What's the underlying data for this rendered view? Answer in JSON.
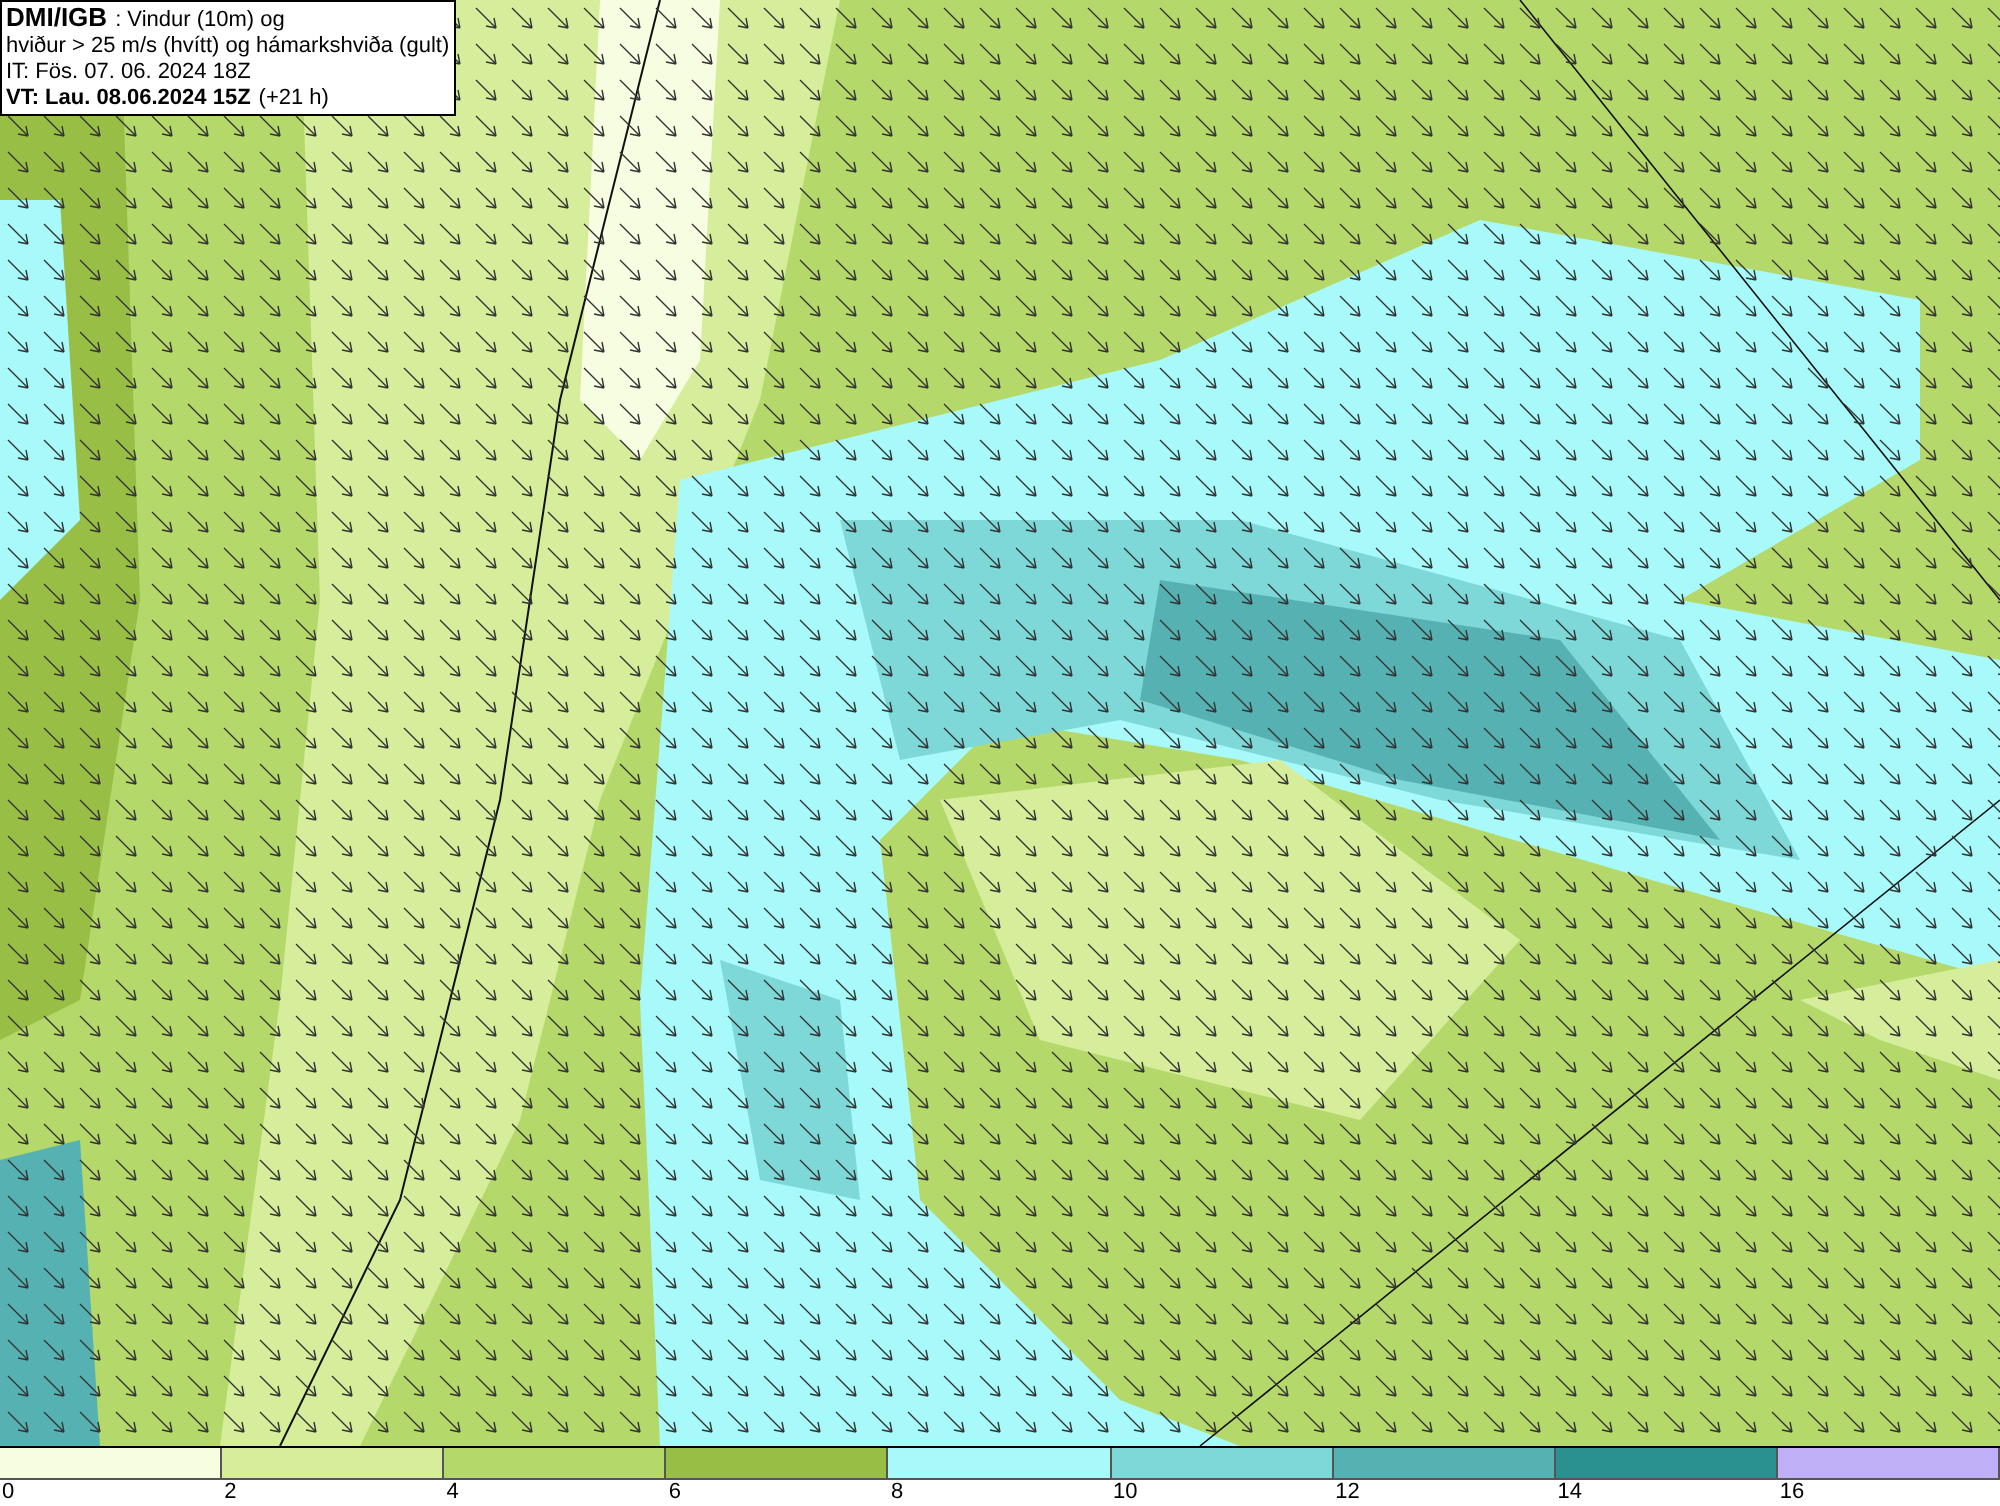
{
  "info_box": {
    "title": "DMI/IGB",
    "subtitle": ": Vindur (10m) og",
    "line_2": "hviður > 25 m/s (hvítt) og hámarkshviða (gult)",
    "issue_time": "IT: Fös. 07. 06. 2024 18Z",
    "valid_label": "VT: Lau. 08.06.2024 15Z",
    "valid_offset": "(+21 h)"
  },
  "legend": [
    {
      "color": "#f7fde0",
      "label": "0"
    },
    {
      "color": "#d6ee9c",
      "label": "2"
    },
    {
      "color": "#b5d86a",
      "label": "4"
    },
    {
      "color": "#98be45",
      "label": "6"
    },
    {
      "color": "#a8fafa",
      "label": "8"
    },
    {
      "color": "#7fd8d8",
      "label": "10"
    },
    {
      "color": "#56b2b2",
      "label": "12"
    },
    {
      "color": "#2a9090",
      "label": "14"
    },
    {
      "color": "#c0b0f8",
      "label": "16"
    }
  ]
}
